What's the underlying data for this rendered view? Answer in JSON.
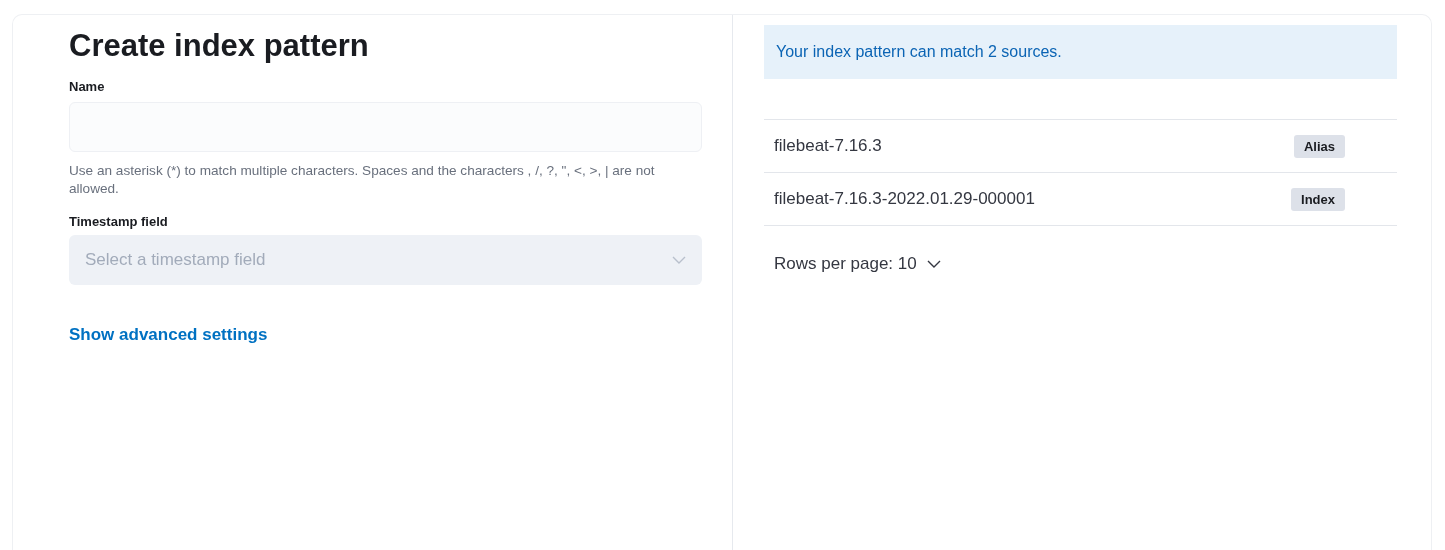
{
  "title": "Create index pattern",
  "name_field": {
    "label": "Name",
    "help": "Use an asterisk (*) to match multiple characters. Spaces and the characters , /, ?, \", <, >, | are not allowed."
  },
  "timestamp_field": {
    "label": "Timestamp field",
    "placeholder": "Select a timestamp field",
    "disabled": true
  },
  "advanced_link": "Show advanced settings",
  "callout": "Your index pattern can match 2 sources.",
  "sources": [
    {
      "name": "filebeat-7.16.3",
      "type": "Alias"
    },
    {
      "name": "filebeat-7.16.3-2022.01.29-000001",
      "type": "Index"
    }
  ],
  "pagination": {
    "label": "Rows per page: 10"
  }
}
